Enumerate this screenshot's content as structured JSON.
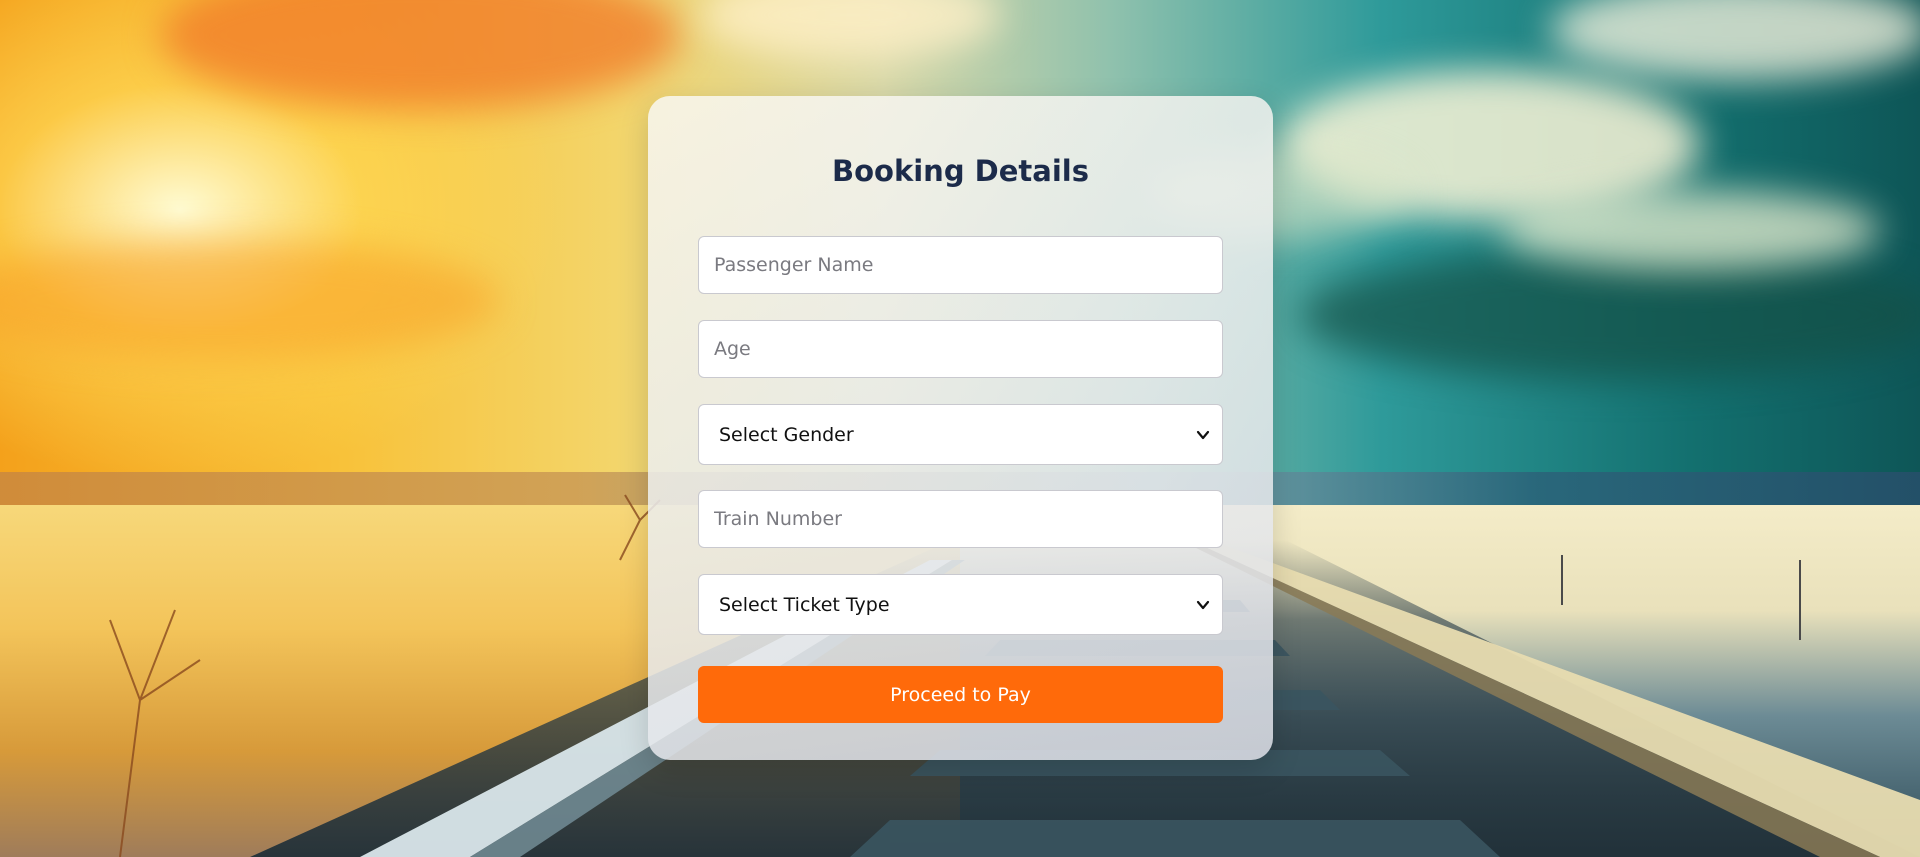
{
  "booking_form": {
    "title": "Booking Details",
    "passenger_name": {
      "placeholder": "Passenger Name",
      "value": ""
    },
    "age": {
      "placeholder": "Age",
      "value": ""
    },
    "gender_select": {
      "selected": "Select Gender"
    },
    "train_number": {
      "placeholder": "Train Number",
      "value": ""
    },
    "ticket_type_select": {
      "selected": "Select Ticket Type"
    },
    "submit_label": "Proceed to Pay"
  },
  "colors": {
    "title": "#1c2b4a",
    "button": "#ff6a0a",
    "button_text": "#ffffff"
  }
}
